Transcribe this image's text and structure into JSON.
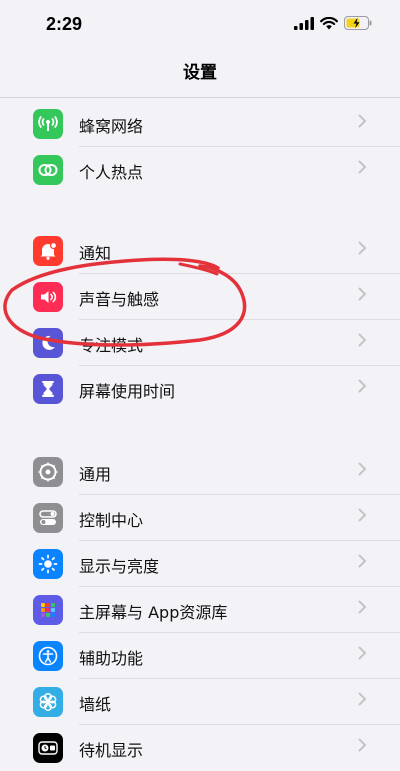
{
  "status_bar": {
    "time": "2:29"
  },
  "nav": {
    "title": "设置"
  },
  "section1": [
    {
      "label": "蜂窝网络",
      "icon": "cellular-antenna-icon",
      "color": "#34c759"
    },
    {
      "label": "个人热点",
      "icon": "hotspot-link-icon",
      "color": "#34c759"
    }
  ],
  "section2": [
    {
      "label": "通知",
      "icon": "bell-notification-icon",
      "color": "#ff3b30"
    },
    {
      "label": "声音与触感",
      "icon": "speaker-volume-icon",
      "color": "#ff2d55"
    },
    {
      "label": "专注模式",
      "icon": "moon-icon",
      "color": "#5856d6"
    },
    {
      "label": "屏幕使用时间",
      "icon": "hourglass-icon",
      "color": "#5856d6"
    }
  ],
  "section3": [
    {
      "label": "通用",
      "icon": "gear-icon",
      "color": "#8e8e93"
    },
    {
      "label": "控制中心",
      "icon": "toggles-icon",
      "color": "#8e8e93"
    },
    {
      "label": "显示与亮度",
      "icon": "sun-brightness-icon",
      "color": "#0a84ff"
    },
    {
      "label": "主屏幕与 App资源库",
      "icon": "app-grid-icon",
      "color": "#5e5ce6"
    },
    {
      "label": "辅助功能",
      "icon": "accessibility-person-icon",
      "color": "#0a84ff"
    },
    {
      "label": "墙纸",
      "icon": "flower-wallpaper-icon",
      "color": "#32ade6"
    },
    {
      "label": "待机显示",
      "icon": "standby-clock-icon",
      "color": "#000000"
    }
  ],
  "annotation": {
    "color": "#e4323a"
  }
}
